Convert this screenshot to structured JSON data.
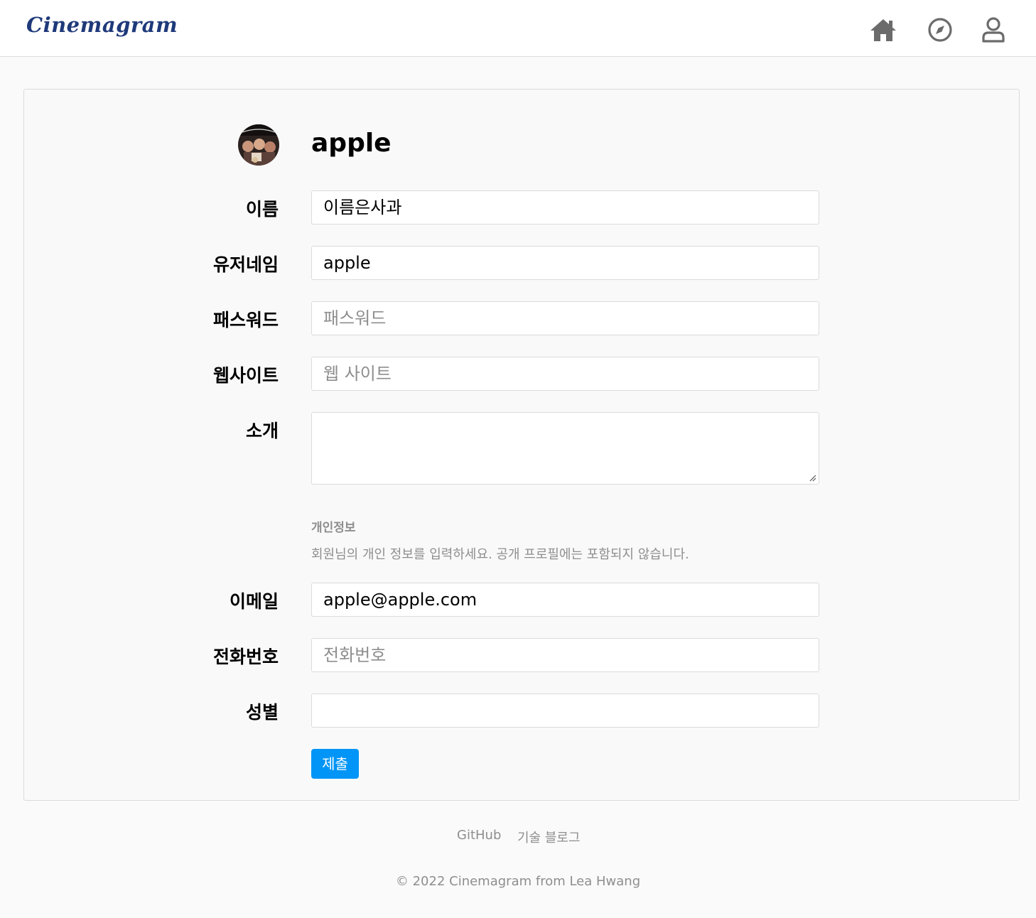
{
  "header": {
    "logo": "Cinemagram",
    "nav": [
      "home-icon",
      "compass-icon",
      "user-icon"
    ]
  },
  "profile": {
    "username": "apple"
  },
  "form": {
    "name_label": "이름",
    "name_value": "이름은사과",
    "username_label": "유저네임",
    "username_value": "apple",
    "password_label": "패스워드",
    "password_placeholder": "패스워드",
    "website_label": "웹사이트",
    "website_placeholder": "웹 사이트",
    "bio_label": "소개",
    "bio_value": "",
    "private_title": "개인정보",
    "private_desc": "회원님의 개인 정보를 입력하세요. 공개 프로필에는 포함되지 않습니다.",
    "email_label": "이메일",
    "email_value": "apple@apple.com",
    "phone_label": "전화번호",
    "phone_placeholder": "전화번호",
    "gender_label": "성별",
    "gender_value": "",
    "submit_label": "제출"
  },
  "footer": {
    "links": [
      "GitHub",
      "기술 블로그"
    ],
    "copyright": "© 2022 Cinemagram from Lea Hwang"
  },
  "colors": {
    "accent": "#0095f6",
    "logo": "#1f3a7a",
    "icon": "#6b6b6b",
    "muted": "#8e8e8e"
  }
}
